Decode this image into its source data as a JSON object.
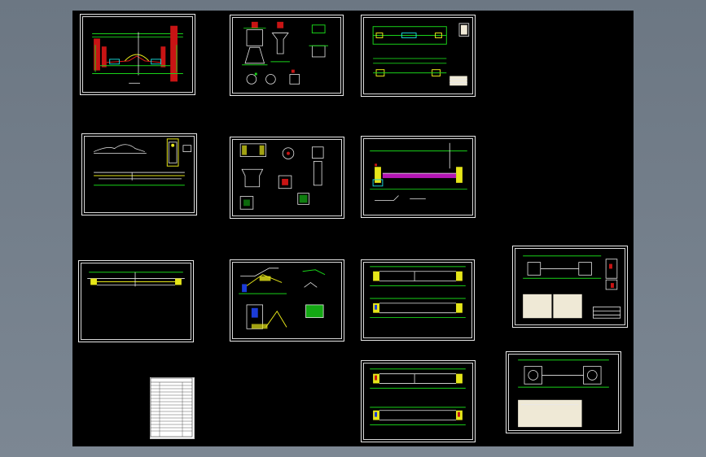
{
  "viewer": {
    "background": "#6f7a86",
    "canvas_background": "#000000"
  },
  "sheets": [
    {
      "id": "sheet-1",
      "row": 1,
      "col": 1,
      "content": "bridge-elevation-red-green"
    },
    {
      "id": "sheet-2",
      "row": 1,
      "col": 2,
      "content": "pier-details"
    },
    {
      "id": "sheet-3",
      "row": 1,
      "col": 3,
      "content": "plan-and-elevation"
    },
    {
      "id": "sheet-4",
      "row": 2,
      "col": 1,
      "content": "profile-elevation"
    },
    {
      "id": "sheet-5",
      "row": 2,
      "col": 2,
      "content": "section-details"
    },
    {
      "id": "sheet-6",
      "row": 2,
      "col": 3,
      "content": "deck-plan"
    },
    {
      "id": "sheet-7",
      "row": 3,
      "col": 1,
      "content": "long-elevation"
    },
    {
      "id": "sheet-8",
      "row": 3,
      "col": 2,
      "content": "stair-details"
    },
    {
      "id": "sheet-9",
      "row": 3,
      "col": 3,
      "content": "beam-reinforcement"
    },
    {
      "id": "sheet-10",
      "row": 3,
      "col": 4,
      "content": "general-layout-with-notes"
    },
    {
      "id": "sheet-11",
      "row": 4,
      "col": 1,
      "content": "drawing-index-table"
    },
    {
      "id": "sheet-12",
      "row": 4,
      "col": 3,
      "content": "beam-reinforcement-2"
    },
    {
      "id": "sheet-13",
      "row": 4,
      "col": 4,
      "content": "general-layout-with-notes-2"
    }
  ]
}
